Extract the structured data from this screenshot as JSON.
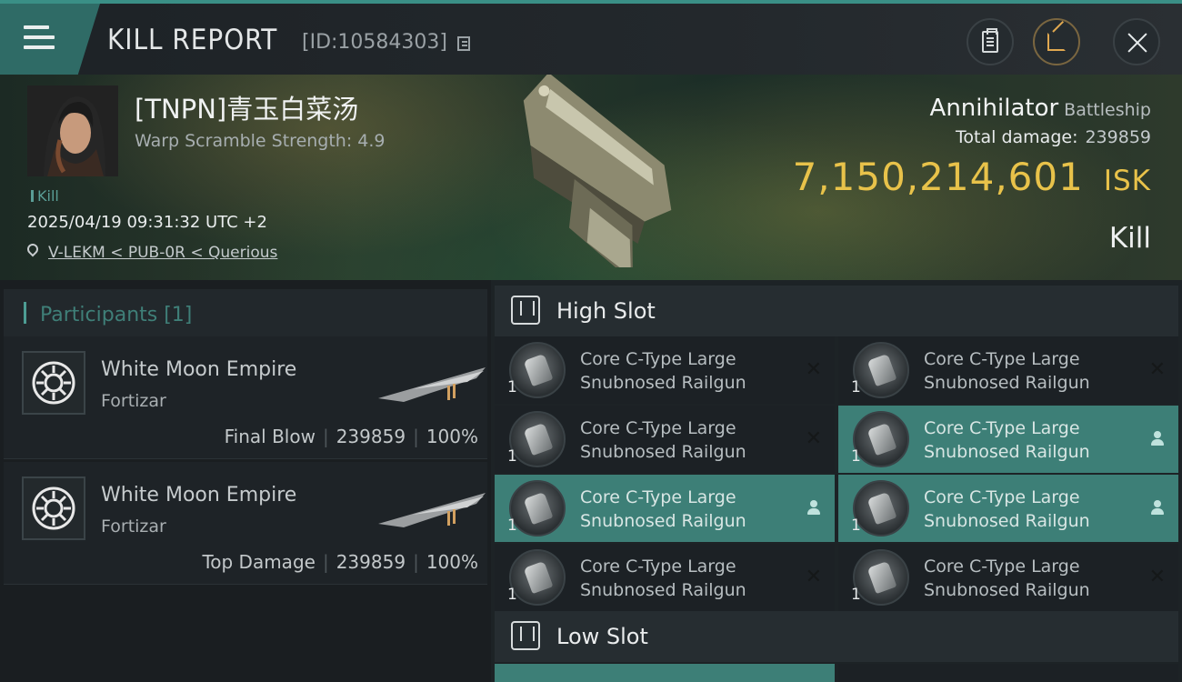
{
  "header": {
    "title": "KILL REPORT",
    "report_id": "[ID:10584303]"
  },
  "victim": {
    "pilot_name": "[TNPN]青玉白菜汤",
    "warp_scramble": "Warp Scramble Strength: 4.9",
    "kill_tag": "Kill",
    "datetime": "2025/04/19 09:31:32 UTC +2",
    "location": "V-LEKM < PUB-0R < Querious",
    "ship_name": "Annihilator",
    "ship_class": "Battleship",
    "total_damage_label": "Total damage:",
    "total_damage_value": "239859",
    "isk_value": "7,150,214,601",
    "isk_unit": "ISK",
    "result": "Kill"
  },
  "participants": {
    "header": "Participants [1]",
    "items": [
      {
        "corp": "White Moon Empire",
        "ship": "Fortizar",
        "role": "Final Blow",
        "damage": "239859",
        "percent": "100%"
      },
      {
        "corp": "White Moon Empire",
        "ship": "Fortizar",
        "role": "Top Damage",
        "damage": "239859",
        "percent": "100%"
      }
    ]
  },
  "slots": {
    "high_label": "High Slot",
    "low_label": "Low Slot",
    "modules": [
      {
        "qty": "1",
        "name": "Core C-Type Large Snubnosed Railgun",
        "state": "destroyed"
      },
      {
        "qty": "1",
        "name": "Core C-Type Large Snubnosed Railgun",
        "state": "destroyed"
      },
      {
        "qty": "1",
        "name": "Core C-Type Large Snubnosed Railgun",
        "state": "destroyed"
      },
      {
        "qty": "1",
        "name": "Core C-Type Large Snubnosed Railgun",
        "state": "dropped"
      },
      {
        "qty": "1",
        "name": "Core C-Type Large Snubnosed Railgun",
        "state": "dropped"
      },
      {
        "qty": "1",
        "name": "Core C-Type Large Snubnosed Railgun",
        "state": "dropped"
      },
      {
        "qty": "1",
        "name": "Core C-Type Large Snubnosed Railgun",
        "state": "destroyed"
      },
      {
        "qty": "1",
        "name": "Core C-Type Large Snubnosed Railgun",
        "state": "destroyed"
      }
    ]
  },
  "icons": {
    "menu": "menu-icon",
    "copy": "copy-icon",
    "clipboard": "clipboard-icon",
    "share": "share-icon",
    "close": "close-icon",
    "location": "location-pin-icon",
    "destroyed": "x-icon",
    "dropped": "person-icon",
    "slot": "slot-icon"
  },
  "colors": {
    "accent": "#3d7f77",
    "isk": "#e8c24a"
  }
}
